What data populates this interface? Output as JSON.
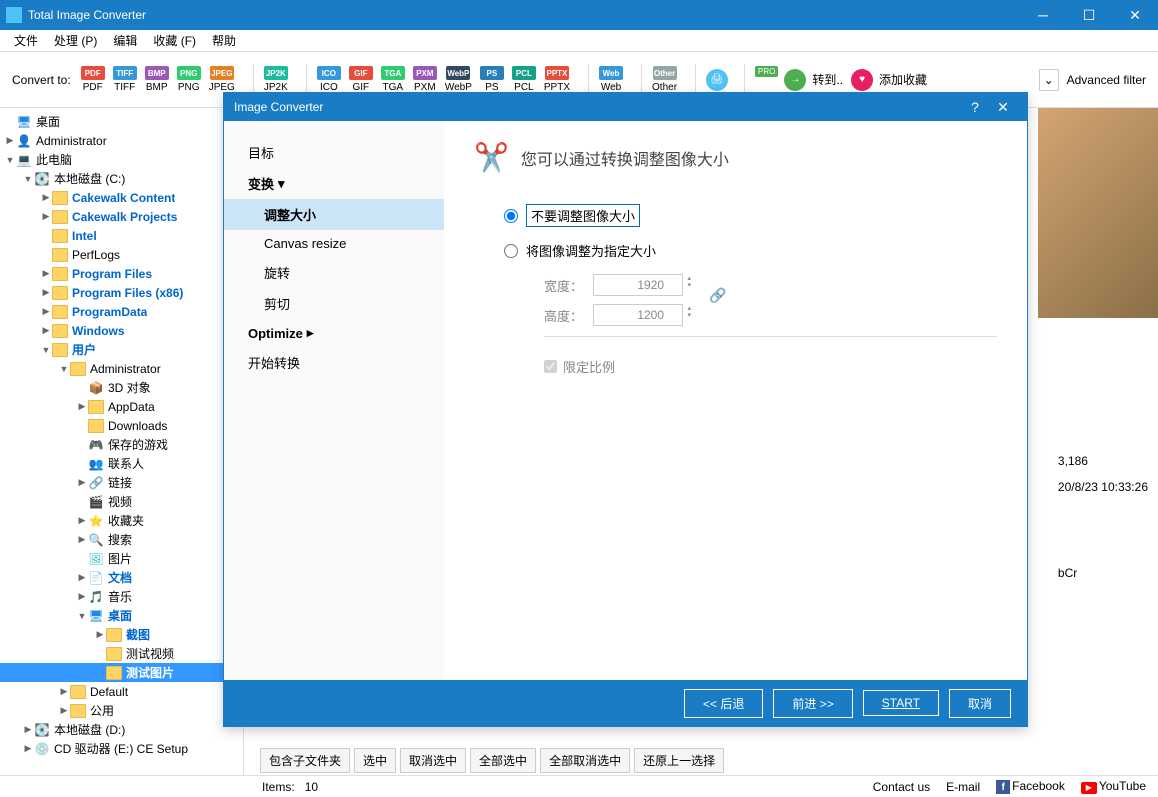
{
  "app": {
    "title": "Total Image Converter"
  },
  "menu": [
    "文件",
    "处理 (P)",
    "编辑",
    "收藏 (F)",
    "帮助"
  ],
  "toolbar": {
    "convert_label": "Convert to:",
    "formats": [
      {
        "label": "PDF",
        "icon": "PDF",
        "color": "#e74c3c"
      },
      {
        "label": "TIFF",
        "icon": "TIFF",
        "color": "#3498db"
      },
      {
        "label": "BMP",
        "icon": "BMP",
        "color": "#9b59b6"
      },
      {
        "label": "PNG",
        "icon": "PNG",
        "color": "#2ecc71"
      },
      {
        "label": "JPEG",
        "icon": "JPEG",
        "color": "#e67e22"
      },
      {
        "label": "JP2K",
        "icon": "JP2K",
        "color": "#1abc9c"
      },
      {
        "label": "ICO",
        "icon": "ICO",
        "color": "#3498db"
      },
      {
        "label": "GIF",
        "icon": "GIF",
        "color": "#e74c3c"
      },
      {
        "label": "TGA",
        "icon": "TGA",
        "color": "#2ecc71"
      },
      {
        "label": "PXM",
        "icon": "PXM",
        "color": "#9b59b6"
      },
      {
        "label": "WebP",
        "icon": "WebP",
        "color": "#34495e"
      },
      {
        "label": "PS",
        "icon": "PS",
        "color": "#2980b9"
      },
      {
        "label": "PCL",
        "icon": "PCL",
        "color": "#16a085"
      },
      {
        "label": "PPTX",
        "icon": "PPTX",
        "color": "#e74c3c"
      },
      {
        "label": "Web",
        "icon": "Web",
        "color": "#3498db"
      },
      {
        "label": "Other",
        "icon": "Other",
        "color": "#95a5a6"
      }
    ],
    "pro": "PRO",
    "goto": "转到..",
    "favorite": "添加收藏",
    "advanced_filter": "Advanced filter"
  },
  "tree": {
    "desktop": "桌面",
    "admin": "Administrator",
    "pc": "此电脑",
    "drive_c": "本地磁盘 (C:)",
    "cakewalk_content": "Cakewalk Content",
    "cakewalk_projects": "Cakewalk Projects",
    "intel": "Intel",
    "perflogs": "PerfLogs",
    "program_files": "Program Files",
    "program_files_x86": "Program Files (x86)",
    "programdata": "ProgramData",
    "windows": "Windows",
    "users": "用户",
    "admin2": "Administrator",
    "obj3d": "3D 对象",
    "appdata": "AppData",
    "downloads": "Downloads",
    "saved_games": "保存的游戏",
    "contacts": "联系人",
    "links": "链接",
    "videos": "视频",
    "favorites": "收藏夹",
    "search": "搜索",
    "pictures": "图片",
    "documents": "文档",
    "music": "音乐",
    "desktop2": "桌面",
    "screenshots": "截图",
    "test_video": "测试视频",
    "test_images": "测试图片",
    "default": "Default",
    "public": "公用",
    "drive_d": "本地磁盘 (D:)",
    "cd_drive": "CD 驱动器 (E:) CE Setup"
  },
  "preview": {
    "size": "3,186",
    "date": "20/8/23 10:33:26",
    "color": "bCr"
  },
  "bottom_buttons": [
    "包含子文件夹",
    "选中",
    "取消选中",
    "全部选中",
    "全部取消选中",
    "还原上一选择"
  ],
  "statusbar": {
    "items_label": "Items:",
    "items_count": "10",
    "contact": "Contact us",
    "email": "E-mail",
    "facebook": "Facebook",
    "youtube": "YouTube"
  },
  "dialog": {
    "title": "Image Converter",
    "sidebar": {
      "target": "目标",
      "transform": "变换",
      "resize": "调整大小",
      "canvas": "Canvas resize",
      "rotate": "旋转",
      "crop": "剪切",
      "optimize": "Optimize",
      "start": "开始转换"
    },
    "heading": "您可以通过转换调整图像大小",
    "opt_no_resize": "不要调整图像大小",
    "opt_resize_to": "将图像调整为指定大小",
    "width_label": "宽度：",
    "height_label": "高度：",
    "width_value": "1920",
    "height_value": "1200",
    "lock_ratio": "限定比例",
    "footer": {
      "back": "<< 后退",
      "forward": "前进 >>",
      "start": "START",
      "cancel": "取消"
    }
  }
}
